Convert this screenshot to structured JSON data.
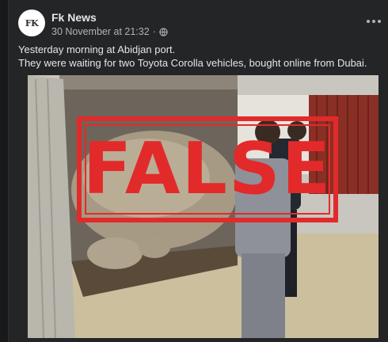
{
  "post": {
    "page_name": "Fk News",
    "avatar_text": "FK",
    "timestamp": "30 November at 21:32",
    "separator": "·",
    "privacy_icon": "globe-icon",
    "more_icon": "more-options-icon",
    "caption_line1": "Yesterday morning at Abidjan port.",
    "caption_line2": "They were waiting for two Toyota Corolla vehicles, bought online from Dubai."
  },
  "photo": {
    "stamp_text": "FALSE",
    "stamp_color": "#e32a2a"
  },
  "colors": {
    "background": "#18191a",
    "card": "#242526",
    "primary_text": "#e4e6eb",
    "secondary_text": "#b0b3b8"
  }
}
